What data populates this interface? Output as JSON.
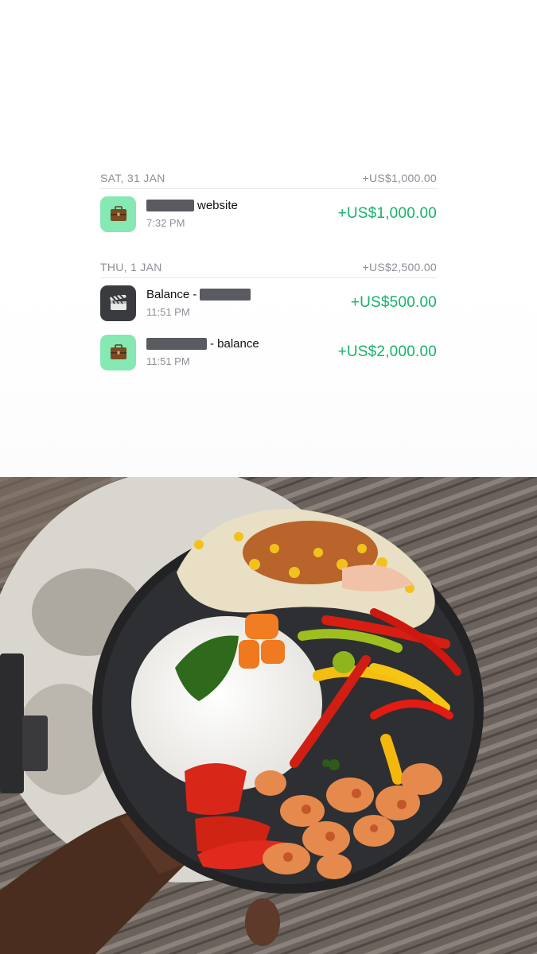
{
  "groups": [
    {
      "date": "SAT, 31 JAN",
      "total": "+US$1,000.00",
      "items": [
        {
          "icon": "briefcase-icon",
          "prefix": "",
          "suffix": "website",
          "time": "7:32 PM",
          "amount": "+US$1,000.00"
        }
      ]
    },
    {
      "date": "THU, 1 JAN",
      "total": "+US$2,500.00",
      "items": [
        {
          "icon": "clapperboard-icon",
          "prefix": "Balance -",
          "suffix": "",
          "time": "11:51 PM",
          "amount": "+US$500.00"
        },
        {
          "icon": "briefcase-icon",
          "prefix": "",
          "suffix": "- balance",
          "time": "11:51 PM",
          "amount": "+US$2,000.00"
        }
      ]
    }
  ],
  "colors": {
    "amount": "#14b36b",
    "muted": "#8d8f96",
    "icon_green": "#86e8b3",
    "icon_dark": "#3a3b3f"
  }
}
